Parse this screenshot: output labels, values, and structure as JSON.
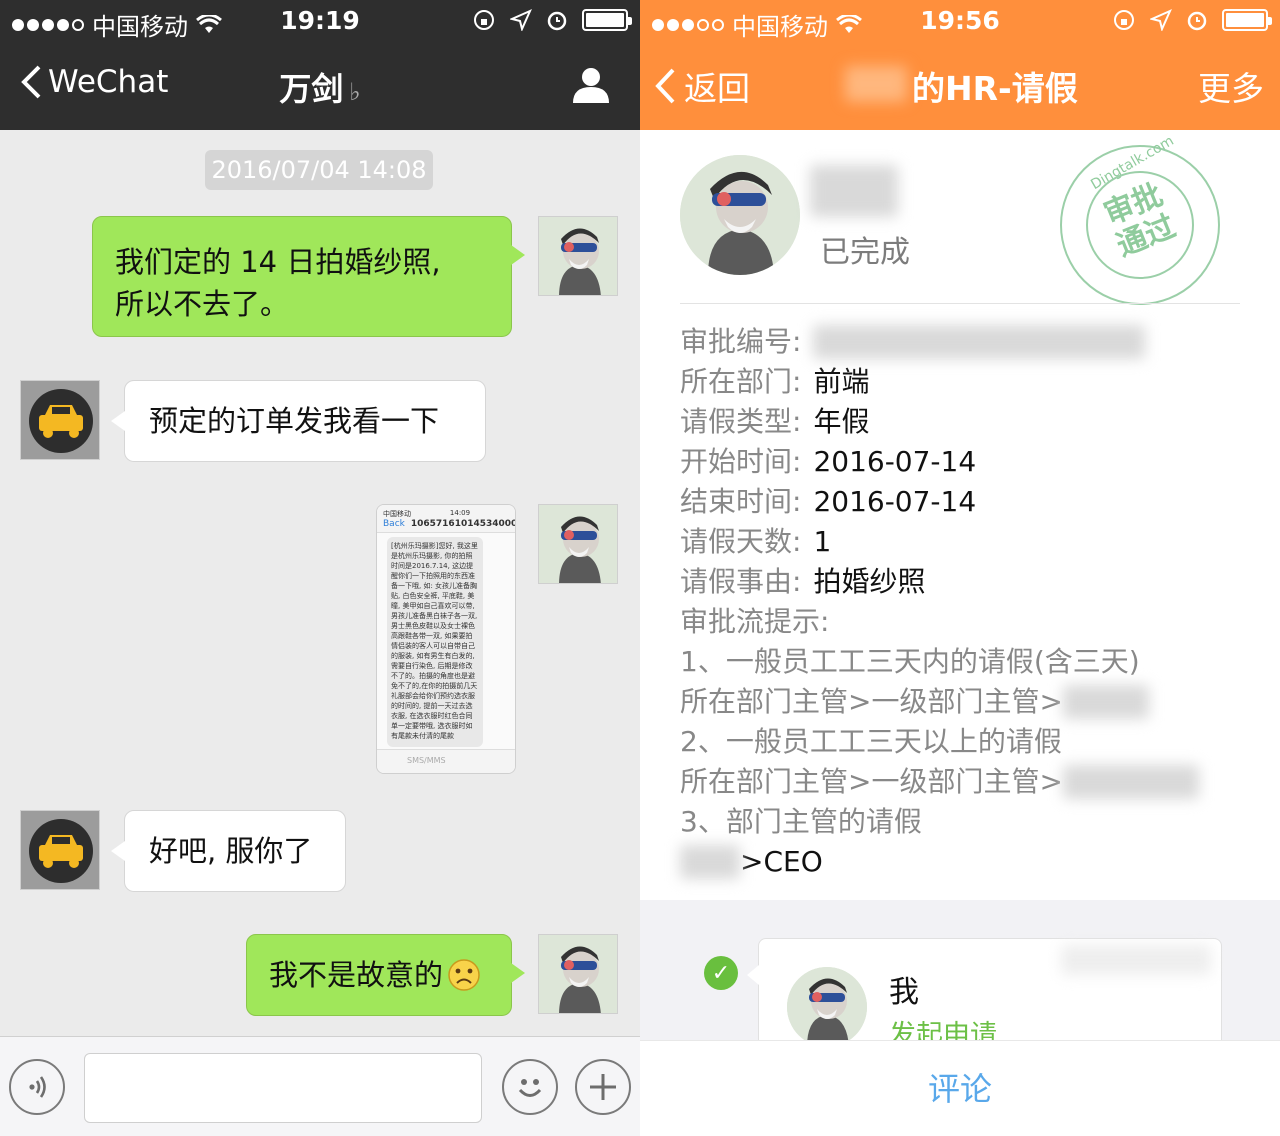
{
  "left": {
    "status": {
      "carrier": "中国移动",
      "time": "19:19"
    },
    "nav": {
      "back_label": "WeChat",
      "title": "万剑"
    },
    "timestamp": "2016/07/04 14:08",
    "messages": [
      {
        "text_line1": "我们定的 14 日拍婚纱照,",
        "text_line2": "所以不去了。"
      },
      {
        "text": "预定的订单发我看一下"
      },
      {
        "text": "好吧,  服你了"
      },
      {
        "text": "我不是故意的"
      }
    ],
    "screenshot_preview": {
      "carrier": "中国移动",
      "time": "14:09",
      "back": "Back",
      "number": "10657161014534000",
      "body": "[杭州乐玛摄影]您好, 我这里是杭州乐玛摄影, 你的拍照时间是2016.7.14, 这边提醒你们一下拍照用的东西准备一下哦, 如: 女孩儿准备胸贴, 白色安全裤, 平底鞋, 美瞳, 美甲如自己喜欢可以带, 男孩儿准备黑白袜子各一双, 男士黑色皮鞋以及女士裸色高跟鞋各带一双, 如果要拍情侣装的客人可以自带自己的服装, 如有男生有白发的, 需要自行染色, 后期是修改不了的。拍摄的角度也是避免不了的,在你的拍摄前几天礼服部会给你们预约选衣服的时间的, 提前一天过去选衣服, 在选衣服时红色合同单一定要带哦, 选衣服时如有尾款未付清的尾款",
      "input_placeholder": "SMS/MMS"
    }
  },
  "right": {
    "status": {
      "carrier": "中国移动",
      "time": "19:56"
    },
    "nav": {
      "back_label": "返回",
      "title": "的HR-请假",
      "more_label": "更多"
    },
    "status_text": "已完成",
    "stamp": {
      "arc": "Dingtalk.com",
      "line1": "审批",
      "line2": "通过"
    },
    "fields": [
      {
        "label": "审批编号:",
        "value": ""
      },
      {
        "label": "所在部门:",
        "value": "前端"
      },
      {
        "label": "请假类型:",
        "value": "年假"
      },
      {
        "label": "开始时间:",
        "value": "2016-07-14"
      },
      {
        "label": "结束时间:",
        "value": "2016-07-14"
      },
      {
        "label": "请假天数:",
        "value": "1"
      },
      {
        "label": "请假事由:",
        "value": "拍婚纱照"
      }
    ],
    "flow_hint": {
      "heading": "审批流提示:",
      "lines": [
        "1、一般员工工三天内的请假(含三天)",
        "所在部门主管>一级部门主管>",
        "2、一般员工工三天以上的请假",
        "所在部门主管>一级部门主管>",
        "3、部门主管的请假",
        ">CEO"
      ]
    },
    "flow_card": {
      "name": "我",
      "action": "发起申请"
    },
    "footer": {
      "comment_label": "评论"
    }
  }
}
